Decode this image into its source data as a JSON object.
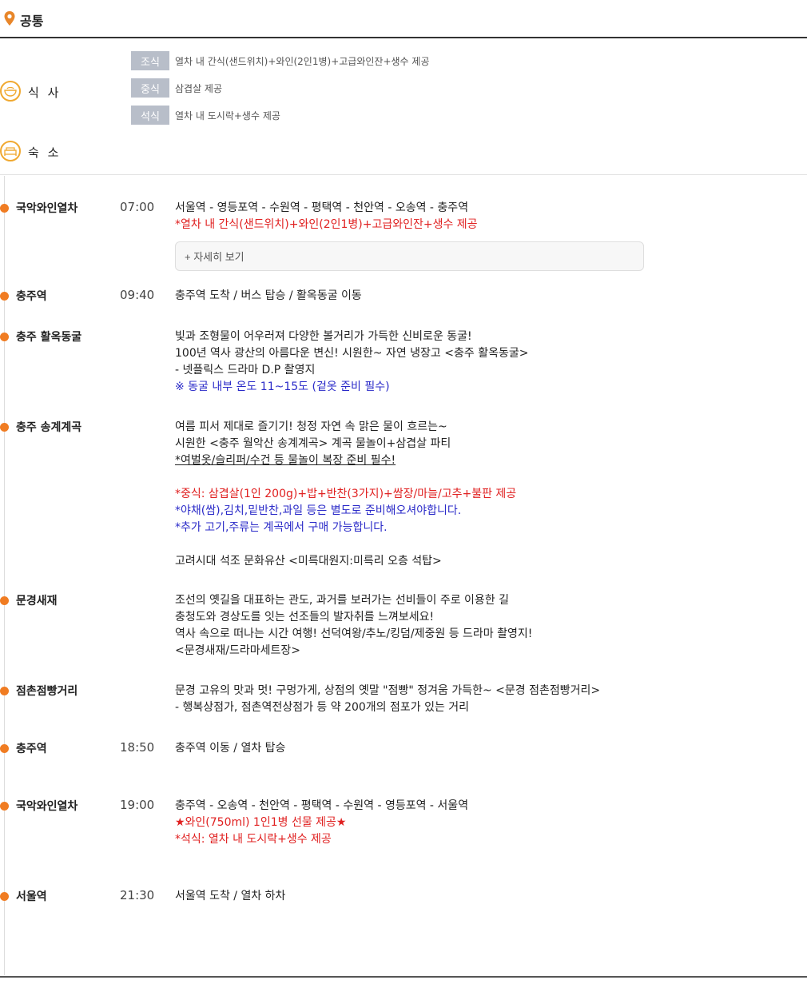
{
  "header": {
    "title": "공통"
  },
  "categories": {
    "meal": "식 사",
    "lodging": "숙 소"
  },
  "meals": [
    {
      "tag": "조식",
      "text": "열차 내 간식(샌드위치)+와인(2인1병)+고급와인잔+생수 제공"
    },
    {
      "tag": "중식",
      "text": "삼겹살 제공"
    },
    {
      "tag": "석식",
      "text": "열차 내 도시락+생수 제공"
    }
  ],
  "more_button": "+ 자세히 보기",
  "stops": [
    {
      "name": "국악와인열차",
      "time": "07:00",
      "lines": [
        {
          "text": "서울역 - 영등포역 - 수원역 - 평택역 - 천안역 -  오송역 - 충주역",
          "style": ""
        },
        {
          "text": "*열차 내 간식(샌드위치)+와인(2인1병)+고급와인잔+생수 제공",
          "style": "red"
        }
      ]
    },
    {
      "name": "충주역",
      "time": "09:40",
      "lines": [
        {
          "text": "충주역 도착 / 버스 탑승 / 활옥동굴 이동",
          "style": ""
        }
      ]
    },
    {
      "name": "충주 활옥동굴",
      "time": "",
      "lines": [
        {
          "text": "빛과 조형물이 어우러져 다양한 볼거리가 가득한 신비로운 동굴!",
          "style": ""
        },
        {
          "text": "100년 역사 광산의 아름다운 변신! 시원한~ 자연 냉장고 <충주 활옥동굴>",
          "style": ""
        },
        {
          "text": "- 넷플릭스 드라마 D.P 촬영지",
          "style": ""
        },
        {
          "text": "※ 동굴 내부 온도 11~15도 (겉옷 준비 필수)",
          "style": "blue"
        }
      ]
    },
    {
      "name": "충주 송계계곡",
      "time": "",
      "lines": [
        {
          "text": "여름 피서 제대로 즐기기! 청정 자연 속 맑은 물이 흐르는~",
          "style": ""
        },
        {
          "text": "시원한 <충주 월악산 송계계곡> 계곡 물놀이+삼겹살 파티",
          "style": ""
        },
        {
          "text": "*여벌옷/슬리퍼/수건 등 물놀이 복장 준비 필수!",
          "style": "ul"
        },
        {
          "text": "",
          "style": ""
        },
        {
          "text": "*중식: 삼겹살(1인 200g)+밥+반찬(3가지)+쌈장/마늘/고추+불판 제공",
          "style": "red"
        },
        {
          "text": "*야채(쌈),김치,밑반찬,과일 등은 별도로 준비해오셔야합니다.",
          "style": "blue"
        },
        {
          "text": "*추가 고기,주류는 계곡에서 구매 가능합니다.",
          "style": "blue"
        },
        {
          "text": "",
          "style": ""
        },
        {
          "text": "고려시대 석조 문화유산 <미륵대원지:미륵리 오층 석탑>",
          "style": ""
        }
      ]
    },
    {
      "name": "문경새재",
      "time": "",
      "lines": [
        {
          "text": "조선의 옛길을 대표하는 관도, 과거를 보러가는 선비들이 주로 이용한 길",
          "style": ""
        },
        {
          "text": "충청도와 경상도를 잇는 선조들의 발자취를 느껴보세요!",
          "style": ""
        },
        {
          "text": "역사 속으로 떠나는 시간 여행! 선덕여왕/추노/킹덤/제중원 등 드라마 촬영지!",
          "style": ""
        },
        {
          "text": "<문경새재/드라마세트장>",
          "style": ""
        }
      ]
    },
    {
      "name": "점촌점빵거리",
      "time": "",
      "lines": [
        {
          "text": "문경 고유의 맛과 멋! 구멍가게, 상점의 옛말 \"점빵\" 정겨움 가득한~ <문경 점촌점빵거리>",
          "style": ""
        },
        {
          "text": "- 행복상점가, 점촌역전상점가 등 약 200개의 점포가 있는 거리",
          "style": ""
        }
      ]
    },
    {
      "name": "충주역",
      "time": "18:50",
      "lines": [
        {
          "text": "충주역 이동 / 열차 탑승",
          "style": ""
        }
      ]
    },
    {
      "name": "국악와인열차",
      "time": "19:00",
      "lines": [
        {
          "text": "충주역 - 오송역 - 천안역 - 평택역 - 수원역 - 영등포역 - 서울역",
          "style": ""
        },
        {
          "text": "★와인(750ml) 1인1병 선물 제공★",
          "style": "red"
        },
        {
          "text": "*석식: 열차 내 도시락+생수 제공",
          "style": "red"
        }
      ]
    },
    {
      "name": "서울역",
      "time": "21:30",
      "lines": [
        {
          "text": "서울역 도착 / 열차 하차",
          "style": ""
        }
      ]
    }
  ],
  "colors": {
    "accent": "#f07c22",
    "red": "#e02020",
    "blue": "#2a2ac8",
    "tag_bg": "#b8bec9"
  }
}
